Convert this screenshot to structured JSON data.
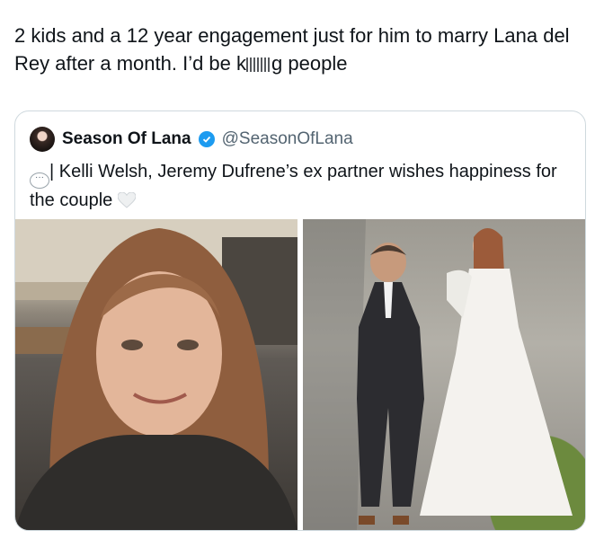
{
  "post": {
    "text_before": "2 kids and a 12 year engagement just for him to marry Lana del Rey after a month. I’d be k",
    "text_after": "g people"
  },
  "quoted_post": {
    "display_name": "Season Of Lana",
    "handle": "@SeasonOfLana",
    "text": "| Kelli Welsh, Jeremy Dufrene’s ex partner wishes happiness for the couple",
    "media": [
      {
        "kind": "photo"
      },
      {
        "kind": "photo"
      }
    ]
  },
  "colors": {
    "text_primary": "#0f1419",
    "text_secondary": "#536471",
    "border": "#cfd9de",
    "verified": "#1d9bf0"
  },
  "icons": [
    "verified-badge-icon",
    "speech-bubble-icon",
    "white-heart-icon"
  ]
}
